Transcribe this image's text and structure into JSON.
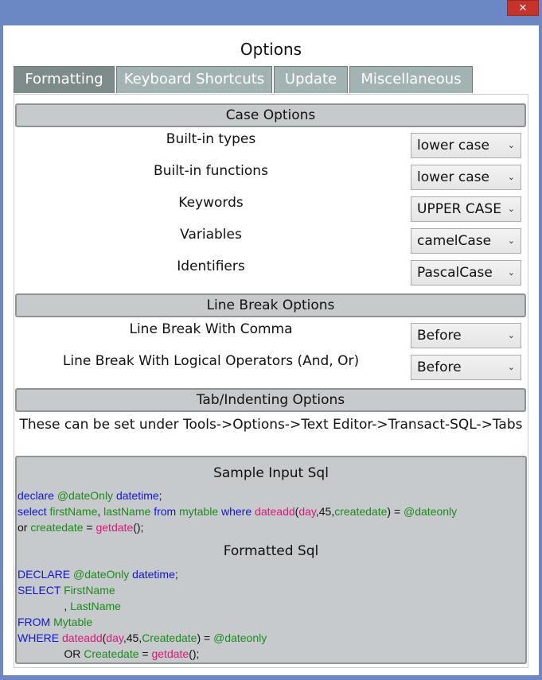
{
  "window": {
    "close_glyph": "✕"
  },
  "dialog": {
    "title": "Options"
  },
  "tabs": [
    {
      "label": "Formatting",
      "active": true
    },
    {
      "label": "Keyboard Shortcuts",
      "active": false
    },
    {
      "label": "Update",
      "active": false
    },
    {
      "label": "Miscellaneous",
      "active": false
    }
  ],
  "case_options": {
    "header": "Case Options",
    "rows": [
      {
        "label": "Built-in types",
        "value": "lower case"
      },
      {
        "label": "Built-in functions",
        "value": "lower case"
      },
      {
        "label": "Keywords",
        "value": "UPPER CASE"
      },
      {
        "label": "Variables",
        "value": "camelCase"
      },
      {
        "label": "Identifiers",
        "value": "PascalCase"
      }
    ]
  },
  "line_break_options": {
    "header": "Line Break Options",
    "rows": [
      {
        "label": "Line Break With Comma",
        "value": "Before"
      },
      {
        "label": "Line Break With Logical Operators (And, Or)",
        "value": "Before"
      }
    ]
  },
  "tab_options": {
    "header": "Tab/Indenting Options",
    "note": "These can be set under Tools->Options->Text Editor->Transact-SQL->Tabs"
  },
  "sample": {
    "input_title": "Sample Input Sql",
    "input_lines": [
      [
        [
          "kw",
          "declare "
        ],
        [
          "id",
          "@dateOnly "
        ],
        [
          "kw",
          "datetime"
        ],
        [
          "tx",
          ";"
        ]
      ],
      [
        [
          "kw",
          "select "
        ],
        [
          "id",
          "firstName"
        ],
        [
          "tx",
          ", "
        ],
        [
          "id",
          "lastName "
        ],
        [
          "kw",
          "from "
        ],
        [
          "id",
          "mytable "
        ],
        [
          "kw",
          "where "
        ],
        [
          "fn",
          "dateadd"
        ],
        [
          "tx",
          "("
        ],
        [
          "fn",
          "day"
        ],
        [
          "tx",
          ",45,"
        ],
        [
          "id",
          "createdate"
        ],
        [
          "tx",
          ") = "
        ],
        [
          "id",
          "@dateonly"
        ]
      ],
      [
        [
          "tx",
          "or "
        ],
        [
          "id",
          "createdate "
        ],
        [
          "tx",
          "= "
        ],
        [
          "fn",
          "getdate"
        ],
        [
          "tx",
          "();"
        ]
      ]
    ],
    "formatted_title": "Formatted Sql",
    "formatted_lines": [
      [
        [
          "kw",
          "DECLARE "
        ],
        [
          "id",
          "@dateOnly "
        ],
        [
          "kw",
          "datetime"
        ],
        [
          "tx",
          ";"
        ]
      ],
      [
        [
          "kw",
          "SELECT "
        ],
        [
          "id",
          "FirstName"
        ]
      ],
      [
        [
          "tx",
          "               , "
        ],
        [
          "id",
          "LastName"
        ]
      ],
      [
        [
          "kw",
          "FROM "
        ],
        [
          "id",
          "Mytable"
        ]
      ],
      [
        [
          "kw",
          "WHERE "
        ],
        [
          "fn",
          "dateadd"
        ],
        [
          "tx",
          "("
        ],
        [
          "fn",
          "day"
        ],
        [
          "tx",
          ",45,"
        ],
        [
          "id",
          "Createdate"
        ],
        [
          "tx",
          ") = "
        ],
        [
          "id",
          "@dateonly"
        ]
      ],
      [
        [
          "tx",
          "               OR "
        ],
        [
          "id",
          "Createdate "
        ],
        [
          "tx",
          "= "
        ],
        [
          "fn",
          "getdate"
        ],
        [
          "tx",
          "();"
        ]
      ]
    ]
  }
}
